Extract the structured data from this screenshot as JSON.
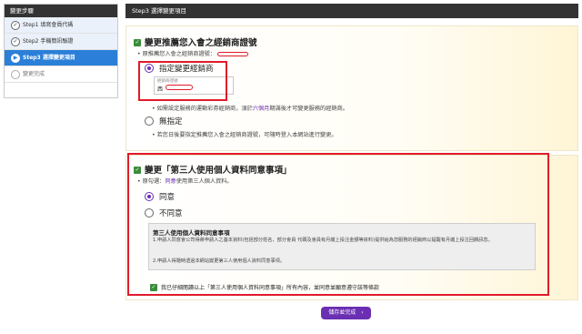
{
  "sidebar": {
    "title": "變更步驟",
    "steps": [
      {
        "label": "Step1 填寫會員代碼",
        "state": "done",
        "icon": "✓"
      },
      {
        "label": "Step2 手機簡訊驗證",
        "state": "done",
        "icon": "✓"
      },
      {
        "label": "Step3 選擇變更項目",
        "state": "active",
        "icon": "▶"
      },
      {
        "label": "變更完成",
        "state": "todo",
        "icon": ""
      }
    ]
  },
  "main": {
    "title": "Step3 選擇變更項目",
    "section1": {
      "title": "變更推薦您入會之經銷商證號",
      "current_note": "原推薦您入會之經銷商證號：",
      "option_specify": "指定變更經銷商",
      "field_label": "經銷商證號",
      "field_prefix": "西",
      "info_prefix": "如需設定服務的運動彩券經銷商，須於",
      "info_highlight": "六個月",
      "info_suffix": "期滿後才可變更服務的經銷商。",
      "option_none": "無指定",
      "none_note": "若您日後要指定推薦您入會之經銷商證號，可隨時登入本網站進行變更。"
    },
    "section2": {
      "title": "變更「第三人使用個人資料同意事項」",
      "current_prefix": "原勾選：",
      "current_value": "同意",
      "current_suffix": "使用第三人個人資料。",
      "option_agree": "同意",
      "option_disagree": "不同意",
      "terms_title": "第三人使用個人資料同意事項",
      "terms_1": "1.申請人同意會公司得將申請人之基本資料(包括部分姓名、部分會員 代碼及會員有月繳上投注金額等資料)提供給為您服務的經銷商以提醒有月繳上投注回饋訊息。",
      "terms_2": "2.申請人得隨時透過本網站變更第三人使用個人資料同意事項。",
      "confirm": "我已仔細閱讀以上「第三人使用個人資料同意事項」所有內容，並同意並願意遵守該等條款"
    },
    "submit_label": "儲存並完成",
    "submit_arrow": "›"
  },
  "colors": {
    "accent_purple": "#6a2fb2",
    "active_blue": "#2b7fd8",
    "check_green": "#3a8d3a",
    "highlight_red": "#e01b2a",
    "header_dark": "#333333"
  }
}
